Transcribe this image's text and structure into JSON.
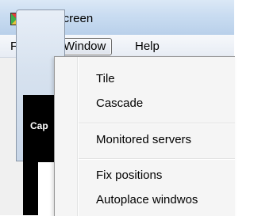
{
  "window": {
    "title": "MultiScreen",
    "app_icon": "multiscreen-app-icon"
  },
  "menubar": {
    "items": [
      {
        "label": "File"
      },
      {
        "label": "Window"
      },
      {
        "label": "Help"
      }
    ]
  },
  "background": {
    "caption_text": "Cap"
  },
  "dropdown": {
    "items": [
      {
        "label": "Tile"
      },
      {
        "label": "Cascade"
      },
      {
        "label": "Monitored servers"
      },
      {
        "label": "Fix positions"
      },
      {
        "label": "Autoplace windwos"
      }
    ]
  }
}
